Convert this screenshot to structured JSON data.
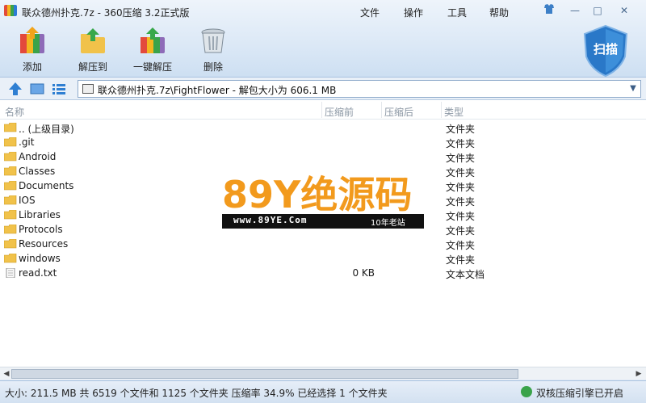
{
  "window": {
    "title": "联众德州扑克.7z - 360压缩 3.2正式版",
    "menu": [
      "文件",
      "操作",
      "工具",
      "帮助"
    ],
    "controls": {
      "minimize": "—",
      "maximize": "□",
      "close": "✕"
    }
  },
  "toolbar": {
    "buttons": [
      "添加",
      "解压到",
      "一键解压",
      "删除"
    ],
    "scan_label": "扫描"
  },
  "address": {
    "path": "联众德州扑克.7z\\FightFlower - 解包大小为 606.1 MB"
  },
  "columns": [
    "名称",
    "压缩前",
    "压缩后",
    "类型"
  ],
  "files": [
    {
      "name": ".. (上级目录)",
      "size": "",
      "type": "文件夹",
      "icon": "folder-icon"
    },
    {
      "name": ".git",
      "size": "",
      "type": "文件夹",
      "icon": "folder-icon"
    },
    {
      "name": "Android",
      "size": "",
      "type": "文件夹",
      "icon": "folder-icon"
    },
    {
      "name": "Classes",
      "size": "",
      "type": "文件夹",
      "icon": "folder-icon"
    },
    {
      "name": "Documents",
      "size": "",
      "type": "文件夹",
      "icon": "folder-icon"
    },
    {
      "name": "IOS",
      "size": "",
      "type": "文件夹",
      "icon": "folder-icon"
    },
    {
      "name": "Libraries",
      "size": "",
      "type": "文件夹",
      "icon": "folder-icon"
    },
    {
      "name": "Protocols",
      "size": "",
      "type": "文件夹",
      "icon": "folder-icon"
    },
    {
      "name": "Resources",
      "size": "",
      "type": "文件夹",
      "icon": "folder-icon"
    },
    {
      "name": "windows",
      "size": "",
      "type": "文件夹",
      "icon": "folder-icon"
    },
    {
      "name": "read.txt",
      "size": "0 KB",
      "type": "文本文档",
      "icon": "text-file-icon"
    }
  ],
  "watermark": {
    "logo_text": "89Y绝源码",
    "url": "www.89YE.Com",
    "slogan": "10年老站"
  },
  "status": {
    "summary": "大小: 211.5 MB 共 6519 个文件和 1125 个文件夹 压缩率 34.9% 已经选择 1 个文件夹",
    "engine": "双核压缩引擎已开启"
  },
  "colors": {
    "accent": "#2f7fd2",
    "folder": "#f1c24a",
    "scan_shield": "#2a78c8"
  }
}
